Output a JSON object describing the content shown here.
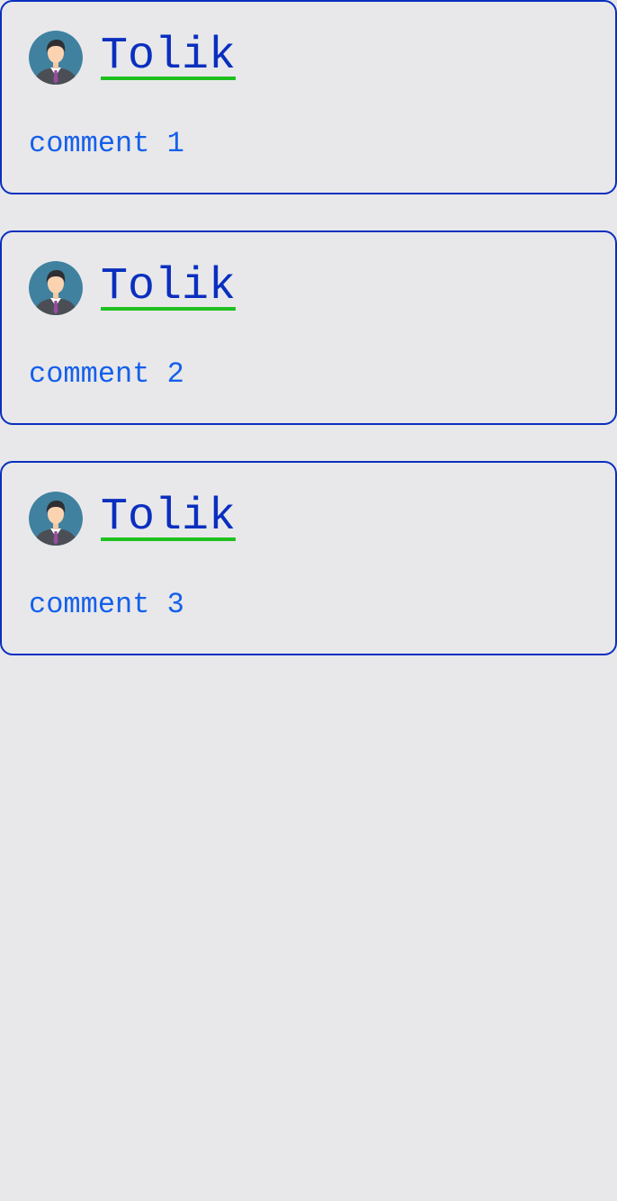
{
  "comments": [
    {
      "author": "Tolik",
      "text": "comment 1",
      "avatar_icon": "user-avatar-icon"
    },
    {
      "author": "Tolik",
      "text": "comment 2",
      "avatar_icon": "user-avatar-icon"
    },
    {
      "author": "Tolik",
      "text": "comment 3",
      "avatar_icon": "user-avatar-icon"
    }
  ],
  "colors": {
    "background": "#e8e8ea",
    "card_border": "#0a2fbf",
    "author_text": "#0a2fbf",
    "author_underline": "#1fc01f",
    "comment_text": "#1560ea"
  }
}
